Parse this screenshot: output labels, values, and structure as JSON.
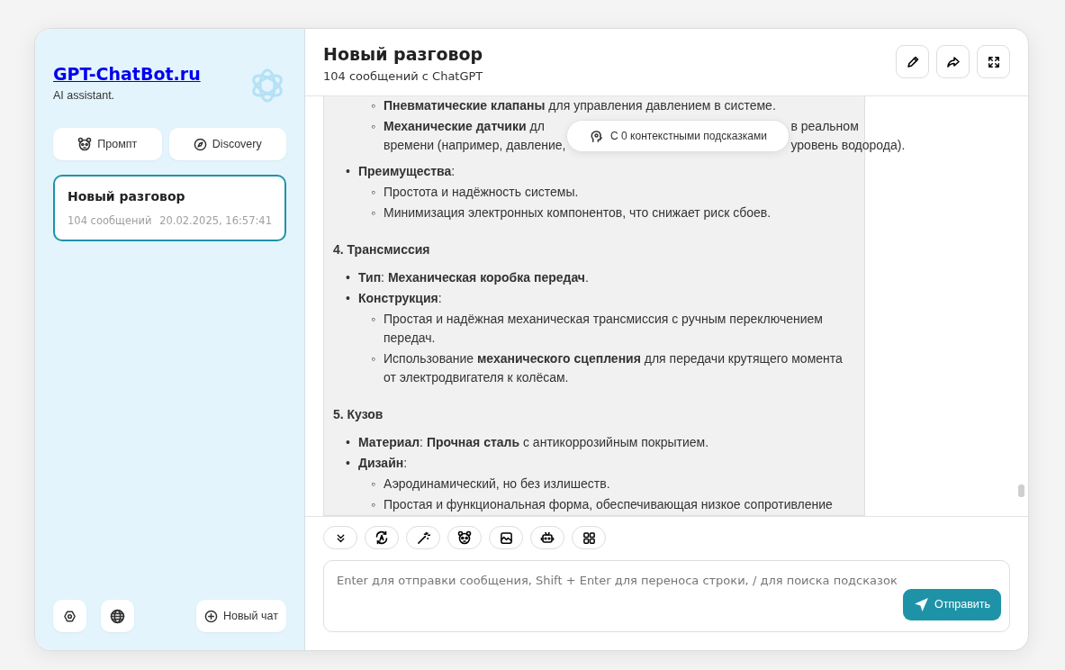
{
  "sidebar": {
    "site_title": "GPT-ChatBot.ru",
    "tagline": "AI assistant.",
    "buttons": [
      "Промпт",
      "Discovery"
    ],
    "chats": [
      {
        "title": "Новый разговор",
        "count": "104 сообщений",
        "date": "20.02.2025, 16:57:41",
        "selected": true
      }
    ],
    "new_chat": "Новый чат"
  },
  "header": {
    "title": "Новый разговор",
    "subtitle": "104 сообщений с ChatGPT"
  },
  "context_pill": "С 0 контекстными подсказками",
  "message": {
    "blocks": [
      {
        "kind": "sublist",
        "items": [
          {
            "marker": "◦",
            "text": "**Пневматические клапаны** для управления давлением в системе."
          },
          {
            "marker": "◦",
            "lines": [
              [
                "**Механические датчики** дл",
                "в реальном"
              ],
              [
                "времени (например, давление,",
                "уровень водорода)."
              ]
            ]
          }
        ]
      },
      {
        "kind": "list",
        "items": [
          {
            "marker": "•",
            "text": "**Преимущества**:",
            "children": [
              {
                "marker": "◦",
                "text": "Простота и надёжность системы."
              },
              {
                "marker": "◦",
                "text": "Минимизация электронных компонентов, что снижает риск сбоев."
              }
            ]
          }
        ]
      },
      {
        "kind": "heading",
        "text": "4. Трансмиссия"
      },
      {
        "kind": "list",
        "items": [
          {
            "marker": "•",
            "text": "**Тип**: **Механическая коробка передач**."
          },
          {
            "marker": "•",
            "text": "**Конструкция**:",
            "children": [
              {
                "marker": "◦",
                "text": "Простая и надёжная механическая трансмиссия с ручным переключением передач."
              },
              {
                "marker": "◦",
                "text": "Использование **механического сцепления** для передачи крутящего момента от электродвигателя к колёсам."
              }
            ]
          }
        ]
      },
      {
        "kind": "heading",
        "text": "5. Кузов"
      },
      {
        "kind": "list",
        "items": [
          {
            "marker": "•",
            "text": "**Материал**: **Прочная сталь** с антикоррозийным покрытием."
          },
          {
            "marker": "•",
            "text": "**Дизайн**:",
            "children": [
              {
                "marker": "◦",
                "text": "Аэродинамический, но без излишеств."
              },
              {
                "marker": "◦",
                "text": "Простая и функциональная форма, обеспечивающая низкое сопротивление"
              }
            ]
          }
        ]
      }
    ]
  },
  "input": {
    "placeholder": "Enter для отправки сообщения, Shift + Enter для переноса строки, / для поиска подсказок",
    "send": "Отправить"
  }
}
